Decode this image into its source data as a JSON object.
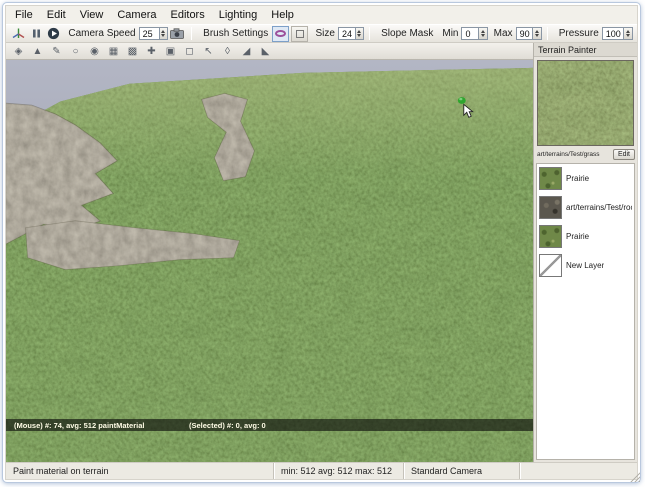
{
  "menu": {
    "items": [
      "File",
      "Edit",
      "View",
      "Camera",
      "Editors",
      "Lighting",
      "Help"
    ]
  },
  "toolbar": {
    "camera_speed_label": "Camera Speed",
    "camera_speed_value": "25",
    "brush_settings_label": "Brush Settings",
    "size_label": "Size",
    "size_value": "24",
    "slope_mask_label": "Slope Mask",
    "min_label": "Min",
    "min_value": "0",
    "max_label": "Max",
    "max_value": "90",
    "pressure_label": "Pressure",
    "pressure_value": "100",
    "icons": [
      "axis-gizmo",
      "pause",
      "play",
      "camera",
      "ellipse-brush",
      "box-brush"
    ]
  },
  "tools": [
    {
      "name": "transform-gizmo",
      "glyph": "◈"
    },
    {
      "name": "raise-height",
      "glyph": "▲"
    },
    {
      "name": "lower-height",
      "glyph": "✎"
    },
    {
      "name": "smooth-height",
      "glyph": "○"
    },
    {
      "name": "paint-noise",
      "glyph": "◉"
    },
    {
      "name": "flatten-height",
      "glyph": "▦"
    },
    {
      "name": "set-height",
      "glyph": "▩"
    },
    {
      "name": "set-empty",
      "glyph": "✚"
    },
    {
      "name": "clear-empty",
      "glyph": "▣"
    },
    {
      "name": "select-terrain",
      "glyph": "◻"
    },
    {
      "name": "adjust-select",
      "glyph": "↖"
    },
    {
      "name": "soft-select",
      "glyph": "◊"
    },
    {
      "name": "ramp-tool",
      "glyph": "◢"
    },
    {
      "name": "mountain-tool",
      "glyph": "◣"
    }
  ],
  "panel": {
    "title": "Terrain Painter",
    "material_path": "art/terrains/Test/grass",
    "edit_label": "Edit",
    "layers": [
      {
        "label": "Prairie",
        "kind": "grass"
      },
      {
        "label": "art/terrains/Test/rock",
        "kind": "rock"
      },
      {
        "label": "Prairie",
        "kind": "grass"
      },
      {
        "label": "New Layer",
        "kind": "new"
      }
    ]
  },
  "viewport": {
    "mouse_info": "(Mouse) #: 74, avg: 512 paintMaterial",
    "selected_info": "(Selected) #: 0, avg: 0"
  },
  "statusbar": {
    "mode": "Paint material on terrain",
    "stats": "min: 512 avg: 512 max: 512",
    "camera": "Standard Camera"
  },
  "colors": {
    "grass": "#5e7b3f",
    "rock": "#8c8577",
    "sky_top": "#b3b6c4",
    "sky_bottom": "#8e93a4",
    "brush_accent": "#9b4f9b"
  }
}
